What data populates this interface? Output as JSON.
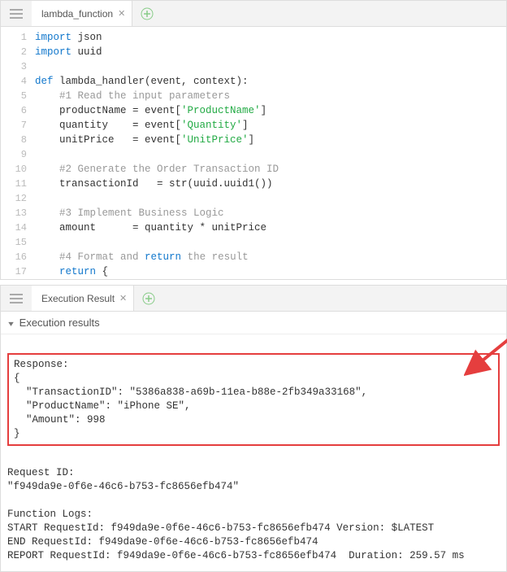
{
  "editor": {
    "tab": {
      "title": "lambda_function"
    },
    "lines": [
      "import json",
      "import uuid",
      "",
      "def lambda_handler(event, context):",
      "    #1 Read the input parameters",
      "    productName = event['ProductName']",
      "    quantity    = event['Quantity']",
      "    unitPrice   = event['UnitPrice']",
      "",
      "    #2 Generate the Order Transaction ID",
      "    transactionId   = str(uuid.uuid1())",
      "",
      "    #3 Implement Business Logic",
      "    amount      = quantity * unitPrice",
      "",
      "    #4 Format and return the result",
      "    return {"
    ]
  },
  "results": {
    "tab": {
      "title": "Execution Result"
    },
    "header": "Execution results",
    "response_label": "Response:",
    "response_body": "{\n  \"TransactionID\": \"5386a838-a69b-11ea-b88e-2fb349a33168\",\n  \"ProductName\": \"iPhone SE\",\n  \"Amount\": 998\n}",
    "request_id_label": "Request ID:",
    "request_id": "\"f949da9e-0f6e-46c6-b753-fc8656efb474\"",
    "logs_label": "Function Logs:",
    "logs": "START RequestId: f949da9e-0f6e-46c6-b753-fc8656efb474 Version: $LATEST\nEND RequestId: f949da9e-0f6e-46c6-b753-fc8656efb474\nREPORT RequestId: f949da9e-0f6e-46c6-b753-fc8656efb474  Duration: 259.57 ms"
  },
  "colors": {
    "highlight": "#e53e3e",
    "keyword": "#1177cc",
    "string": "#22aa44",
    "comment": "#999"
  }
}
